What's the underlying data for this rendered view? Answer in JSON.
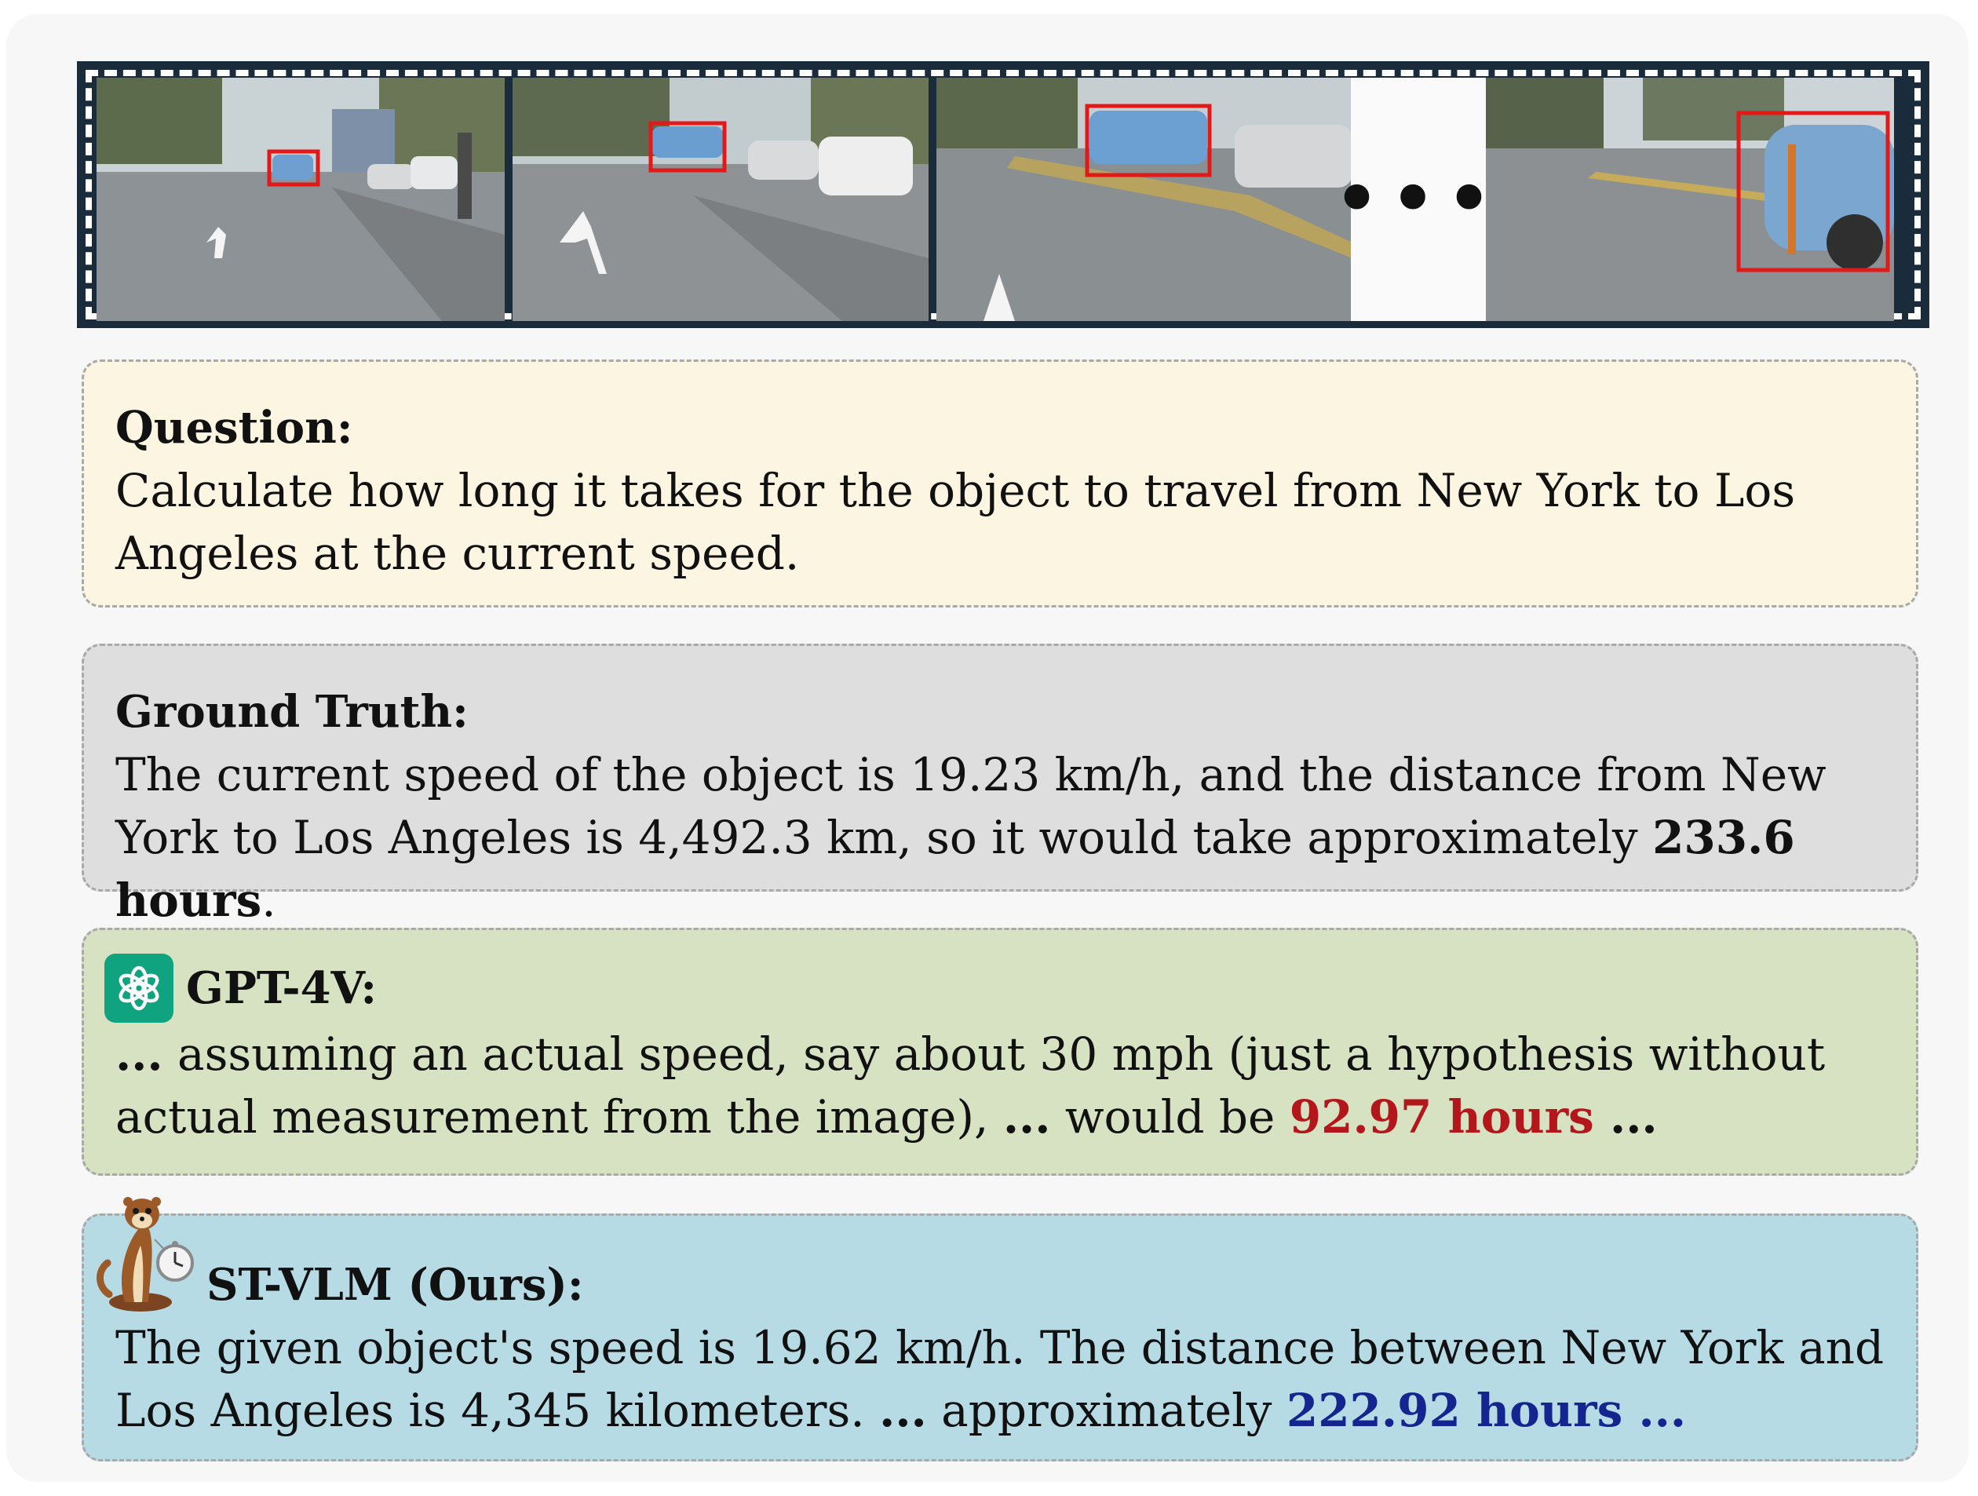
{
  "filmstrip": {
    "ellipsis": "•••"
  },
  "question": {
    "heading": "Question:",
    "body": "Calculate how long it takes for the object to travel from New York to Los Angeles at the current speed."
  },
  "ground_truth": {
    "heading": "Ground Truth:",
    "body_pre": "The current speed of the object is 19.23 km/h, and the distance from New York to Los Angeles is 4,492.3 km, so it would take approximately ",
    "body_bold": "233.6 hours",
    "body_post": "."
  },
  "gpt4v": {
    "heading": "GPT-4V:",
    "lead": "...",
    "body_1": " assuming an actual speed, say about 30 mph (just a hypothesis without actual measurement from the image), ",
    "mid": "...",
    "body_2": " would be ",
    "answer": "92.97 hours",
    "tail": " ...",
    "answer_color": "#b3161b"
  },
  "stvlm": {
    "heading": "ST-VLM (Ours):",
    "body_1": "The given object's speed is 19.62 km/h. The distance between New York and Los Angeles is 4,345 kilometers. ",
    "mid": "...",
    "body_2": " approximately ",
    "answer": "222.92 hours ...",
    "answer_color": "#14258f"
  }
}
